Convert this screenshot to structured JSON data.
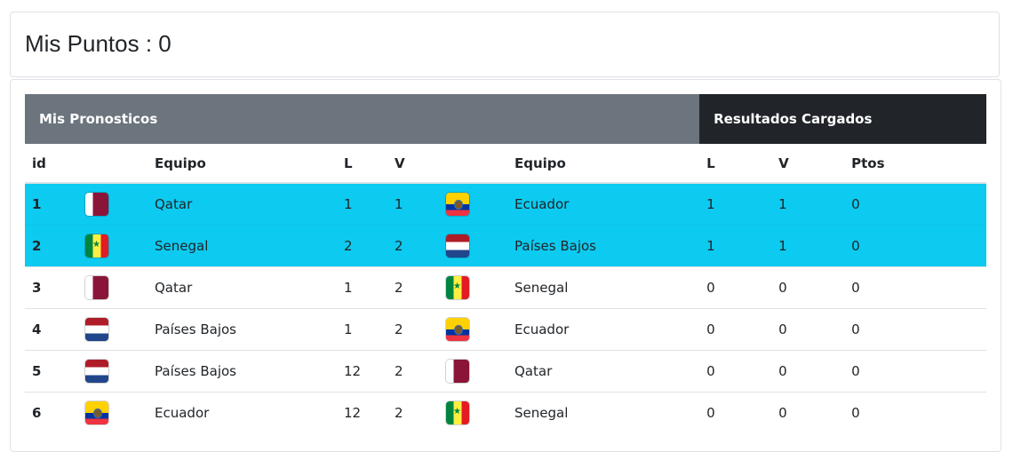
{
  "header": {
    "title": "Mis Puntos : 0"
  },
  "table": {
    "groups": {
      "left": "Mis Pronosticos",
      "right": "Resultados Cargados"
    },
    "columns": {
      "id": "id",
      "equipo1": "Equipo",
      "l1": "L",
      "v1": "V",
      "equipo2": "Equipo",
      "l2": "L",
      "v2": "V",
      "ptos": "Ptos"
    },
    "rows": [
      {
        "id": "1",
        "flag1": "qatar-flag-icon",
        "team1": "Qatar",
        "l": "1",
        "v": "1",
        "flag2": "ecuador-flag-icon",
        "team2": "Ecuador",
        "rl": "1",
        "rv": "1",
        "ptos": "0",
        "highlight": true
      },
      {
        "id": "2",
        "flag1": "senegal-flag-icon",
        "team1": "Senegal",
        "l": "2",
        "v": "2",
        "flag2": "netherlands-flag-icon",
        "team2": "Países Bajos",
        "rl": "1",
        "rv": "1",
        "ptos": "0",
        "highlight": true
      },
      {
        "id": "3",
        "flag1": "qatar-flag-icon",
        "team1": "Qatar",
        "l": "1",
        "v": "2",
        "flag2": "senegal-flag-icon",
        "team2": "Senegal",
        "rl": "0",
        "rv": "0",
        "ptos": "0",
        "highlight": false
      },
      {
        "id": "4",
        "flag1": "netherlands-flag-icon",
        "team1": "Países Bajos",
        "l": "1",
        "v": "2",
        "flag2": "ecuador-flag-icon",
        "team2": "Ecuador",
        "rl": "0",
        "rv": "0",
        "ptos": "0",
        "highlight": false
      },
      {
        "id": "5",
        "flag1": "netherlands-flag-icon",
        "team1": "Países Bajos",
        "l": "12",
        "v": "2",
        "flag2": "qatar-flag-icon",
        "team2": "Qatar",
        "rl": "0",
        "rv": "0",
        "ptos": "0",
        "highlight": false
      },
      {
        "id": "6",
        "flag1": "ecuador-flag-icon",
        "team1": "Ecuador",
        "l": "12",
        "v": "2",
        "flag2": "senegal-flag-icon",
        "team2": "Senegal",
        "rl": "0",
        "rv": "0",
        "ptos": "0",
        "highlight": false
      }
    ]
  },
  "colors": {
    "highlight_row": "#0dcaf0",
    "group_left_bg": "#6c757d",
    "group_right_bg": "#212529"
  }
}
